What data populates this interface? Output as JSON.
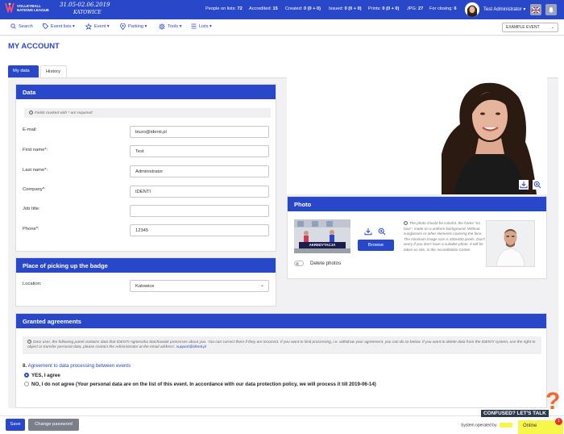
{
  "header": {
    "logo_line1": "VOLLEYBALL",
    "logo_line2": "NATIONS LEAGUE",
    "event_dates": "31.05-02.06.2019",
    "event_city": "KATOWICE",
    "stats": [
      {
        "label": "People on lists:",
        "value": "72"
      },
      {
        "label": "Accredited:",
        "value": "15"
      },
      {
        "label": "Created:",
        "value": "0 (0 + 0)"
      },
      {
        "label": "Issued:",
        "value": "0 (0 + 0)"
      },
      {
        "label": "Prints:",
        "value": "0 (0 + 0)"
      },
      {
        "label": "JPG:",
        "value": "27"
      },
      {
        "label": "For closing:",
        "value": "6"
      }
    ],
    "user_name": "Test Administrator ▾",
    "colors": {
      "primary": "#2947c9",
      "accent_yellow": "#f7f74b"
    }
  },
  "menu": {
    "items": [
      "Search",
      "Event lists ▾",
      "Event ▾",
      "Parking ▾",
      "Tools ▾",
      "Lists ▾"
    ],
    "event_select": "EXAMPLE EVENT"
  },
  "page": {
    "title": "MY ACCOUNT",
    "tabs": [
      "My data",
      "History"
    ]
  },
  "data_panel": {
    "title": "Data",
    "required_note": "Fields marked with * are required!",
    "fields": [
      {
        "label": "E-mail:",
        "value": "biuro@identi.pl"
      },
      {
        "label": "First name*:",
        "value": "Test"
      },
      {
        "label": "Last name*:",
        "value": "Administrator"
      },
      {
        "label": "Company*:",
        "value": "IDENTI"
      },
      {
        "label": "Job title:",
        "value": ""
      },
      {
        "label": "Phone*:",
        "value": "12345"
      }
    ]
  },
  "badge_panel": {
    "title": "Place of picking up the badge",
    "location_label": "Location:",
    "location_value": "Katowice"
  },
  "photo_panel": {
    "title": "Photo",
    "browse_label": "Browse",
    "delete_label": "Delete photos",
    "thumb_banner": "AKREDYTACJA",
    "hint": "The photo should be colorful, the frame \"en face\", made on a uniform background. Without sunglasses or other elements covering the face. The minimum image size is 400x400 pixels. Don't worry if you don't have a suitable photo. It will be taken on site, in the Accreditation Center."
  },
  "agreements_panel": {
    "title": "Granted agreements",
    "text": "Dear user, the following panel contains data that IDENTI Agnieszka Stachowiak processes about you. You can correct them if they are incorrect. If you want to limit processing, i.e. withdraw your agreement, you can do so below. If you want to delete data from the IDENTI system, use the right to object or transfer personal data, please contact the Administrator at the email address:",
    "email": "support@identi.pl",
    "question_num": "8.",
    "question": "Agreement to data processing between events",
    "option_yes": "YES, I agree",
    "option_no": "NO, I do not agree (Your personal data are on the list of this event. In accordance with our data protection policy, we will process it till 2019-06-14)"
  },
  "footer": {
    "save_label": "Save",
    "change_password_label": "Change password",
    "system_operated": "System operated by",
    "confused_label": "CONFUSED? LET'S TALK",
    "online_label": "Online",
    "badge_count": "1"
  }
}
